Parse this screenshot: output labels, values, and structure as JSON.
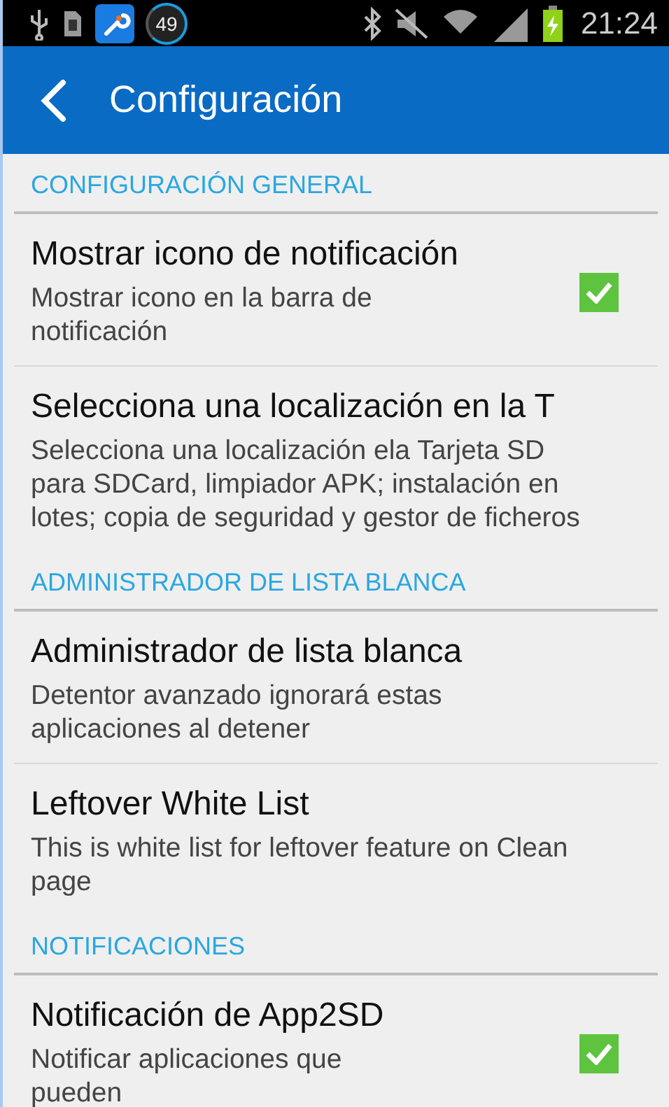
{
  "status_bar": {
    "badge": "49",
    "time": "21:24"
  },
  "header": {
    "title": "Configuración"
  },
  "sections": [
    {
      "title": "CONFIGURACIÓN GENERAL",
      "items": [
        {
          "kind": "checkbox",
          "title": "Mostrar icono de notificación",
          "summary": "Mostrar icono en la barra de notificación",
          "checked": true
        },
        {
          "kind": "link",
          "title": "Selecciona una localización en la T",
          "summary": "Selecciona una localización ela Tarjeta SD para SDCard, limpiador APK; instalación en lotes; copia de seguridad y gestor de ficheros"
        }
      ]
    },
    {
      "title": "ADMINISTRADOR DE LISTA BLANCA",
      "items": [
        {
          "kind": "link",
          "title": "Administrador de lista blanca",
          "summary": "Detentor avanzado ignorará estas aplicaciones al detener"
        },
        {
          "kind": "link",
          "title": "Leftover White List",
          "summary": "This is white list for leftover feature on Clean page"
        }
      ]
    },
    {
      "title": "NOTIFICACIONES",
      "items": [
        {
          "kind": "checkbox",
          "title": "Notificación de App2SD",
          "summary": "Notificar aplicaciones que pueden",
          "checked": true
        }
      ]
    }
  ]
}
